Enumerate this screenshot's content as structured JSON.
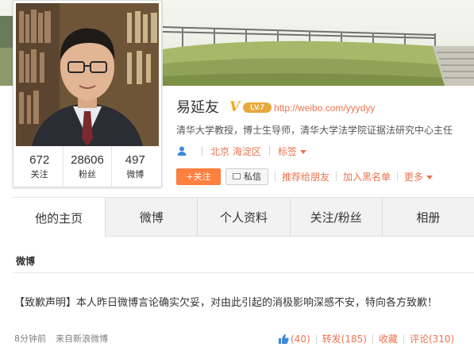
{
  "profile": {
    "name": "易延友",
    "verified_mark": "V",
    "vip_level": "LV.7",
    "url": "http://weibo.com/yyydyy",
    "bio": "清华大学教授，博士生导师，清华大学法学院证据法研究中心主任",
    "location": "北京 海淀区",
    "tags_label": "标签"
  },
  "stats": [
    {
      "value": "672",
      "label": "关注"
    },
    {
      "value": "28606",
      "label": "粉丝"
    },
    {
      "value": "497",
      "label": "微博"
    }
  ],
  "actions": {
    "follow": "+关注",
    "message": "私信",
    "recommend": "推荐给朋友",
    "blacklist": "加入黑名单",
    "more": "更多"
  },
  "tabs": [
    {
      "label": "他的主页",
      "active": true
    },
    {
      "label": "微博",
      "active": false
    },
    {
      "label": "个人资料",
      "active": false
    },
    {
      "label": "关注/粉丝",
      "active": false
    },
    {
      "label": "相册",
      "active": false
    }
  ],
  "feed": {
    "section_title": "微博",
    "post": {
      "text": "【致歉声明】本人昨日微博言论确实欠妥，对由此引起的消极影响深感不安，特向各方致歉！",
      "time": "8分钟前",
      "source": "来自新浪微博",
      "likes": "(40)",
      "repost": "转发(185)",
      "favorite": "收藏",
      "comment": "评论(310)"
    }
  },
  "colors": {
    "accent": "#eb7350",
    "follow_button": "#ff8140",
    "vip_badge": "#e8a93c",
    "verified": "#f5a623"
  },
  "icons": [
    "user-icon",
    "message-icon",
    "thumbs-up-icon",
    "caret-down-icon"
  ]
}
